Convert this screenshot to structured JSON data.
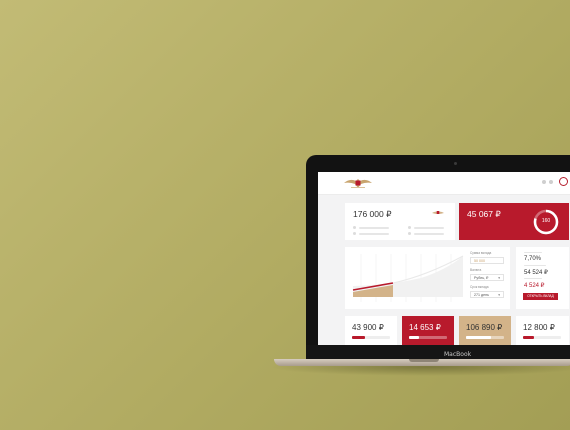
{
  "device": {
    "label": "MacBook"
  },
  "header": {
    "logo_icon": "eagle-emblem-icon",
    "avatar_icon": "profile-ring-icon"
  },
  "balance_card": {
    "amount": "176 000 ₽",
    "icon": "emblem-icon"
  },
  "summary_card": {
    "amount": "45 067 ₽",
    "ring_value": "160",
    "color": "#b81a2c"
  },
  "deposit_form": {
    "sum_label": "Сумма вклада",
    "sum_value": "50 000",
    "currency_label": "Валюта",
    "currency_value": "Рубль, ₽",
    "term_label": "Срок вклада",
    "term_value": "271 день"
  },
  "deposit_stats": {
    "rate_value": "7,70%",
    "total_value": "54 524 ₽",
    "income_value": "4 524 ₽",
    "button_label": "ОТКРЫТЬ ВКЛАД"
  },
  "tiles": [
    {
      "amount": "43 900 ₽",
      "progress": 0.35
    },
    {
      "amount": "14 653 ₽",
      "progress": 0.25
    },
    {
      "amount": "106 890 ₽",
      "progress": 0.65
    },
    {
      "amount": "12 800 ₽",
      "progress": 0.3
    }
  ],
  "colors": {
    "accent": "#b81a2c",
    "gold": "#d3b389",
    "background": "#b1ab62"
  }
}
